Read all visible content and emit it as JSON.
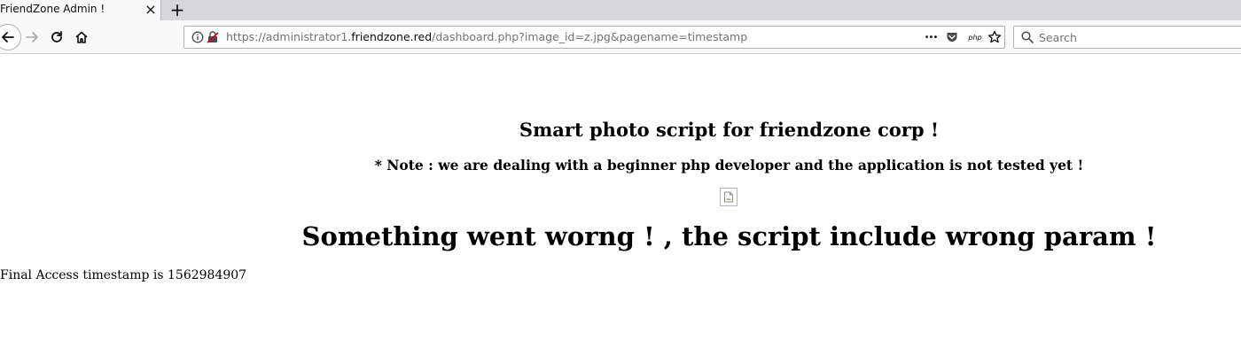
{
  "browser": {
    "tab": {
      "title": "FriendZone Admin !",
      "close_glyph": "×"
    },
    "new_tab_glyph": "+",
    "url": {
      "scheme": "https://administrator1.",
      "domain": "friendzone.red",
      "path": "/dashboard.php?image_id=z.jpg&pagename=timestamp"
    },
    "page_actions": {
      "more_glyph": "•••",
      "php_label": "php"
    },
    "search": {
      "placeholder": "Search"
    }
  },
  "page": {
    "title": "Smart photo script for friendzone corp !",
    "note": "* Note : we are dealing with a beginner php developer and the application is not tested yet !",
    "error": "Something went worng ! , the script include wrong param !",
    "timestamp_line": "Final Access timestamp is 1562984907"
  }
}
